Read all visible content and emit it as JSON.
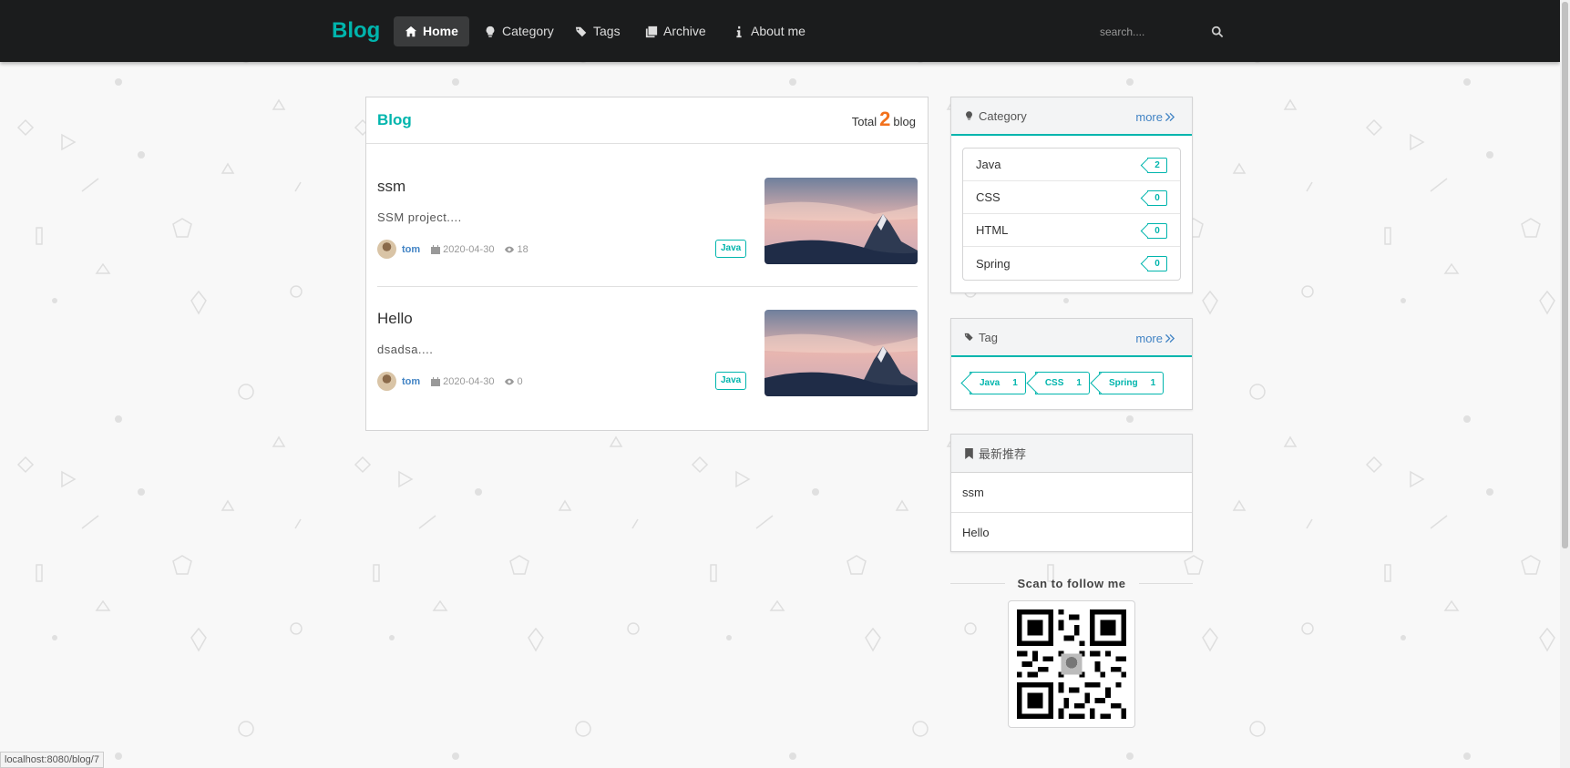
{
  "nav": {
    "brand": "Blog",
    "items": [
      {
        "label": "Home",
        "icon": "home-icon",
        "active": true
      },
      {
        "label": "Category",
        "icon": "lightbulb-icon"
      },
      {
        "label": "Tags",
        "icon": "tags-icon"
      },
      {
        "label": "Archive",
        "icon": "clone-icon"
      },
      {
        "label": "About me",
        "icon": "info-icon"
      }
    ],
    "search_placeholder": "search....",
    "search_icon": "search-icon"
  },
  "main": {
    "title": "Blog",
    "total_prefix": "Total",
    "total_count": "2",
    "total_suffix": "blog",
    "posts": [
      {
        "title": "ssm",
        "excerpt": "SSM project....",
        "author": "tom",
        "date": "2020-04-30",
        "views": "18",
        "tag": "Java"
      },
      {
        "title": "Hello",
        "excerpt": "dsadsa....",
        "author": "tom",
        "date": "2020-04-30",
        "views": "0",
        "tag": "Java"
      }
    ]
  },
  "sidebar": {
    "category": {
      "title": "Category",
      "more": "more",
      "items": [
        {
          "name": "Java",
          "count": "2"
        },
        {
          "name": "CSS",
          "count": "0"
        },
        {
          "name": "HTML",
          "count": "0"
        },
        {
          "name": "Spring",
          "count": "0"
        }
      ]
    },
    "tag": {
      "title": "Tag",
      "more": "more",
      "items": [
        {
          "name": "Java",
          "count": "1"
        },
        {
          "name": "CSS",
          "count": "1"
        },
        {
          "name": "Spring",
          "count": "1"
        }
      ]
    },
    "recommend": {
      "title": "最新推荐",
      "items": [
        "ssm",
        "Hello"
      ]
    },
    "follow": "Scan to follow me"
  },
  "status_url": "localhost:8080/blog/7",
  "colors": {
    "accent": "#00b5ad",
    "count": "#f2711c",
    "link": "#4183c4",
    "navbar": "#1b1c1d"
  }
}
